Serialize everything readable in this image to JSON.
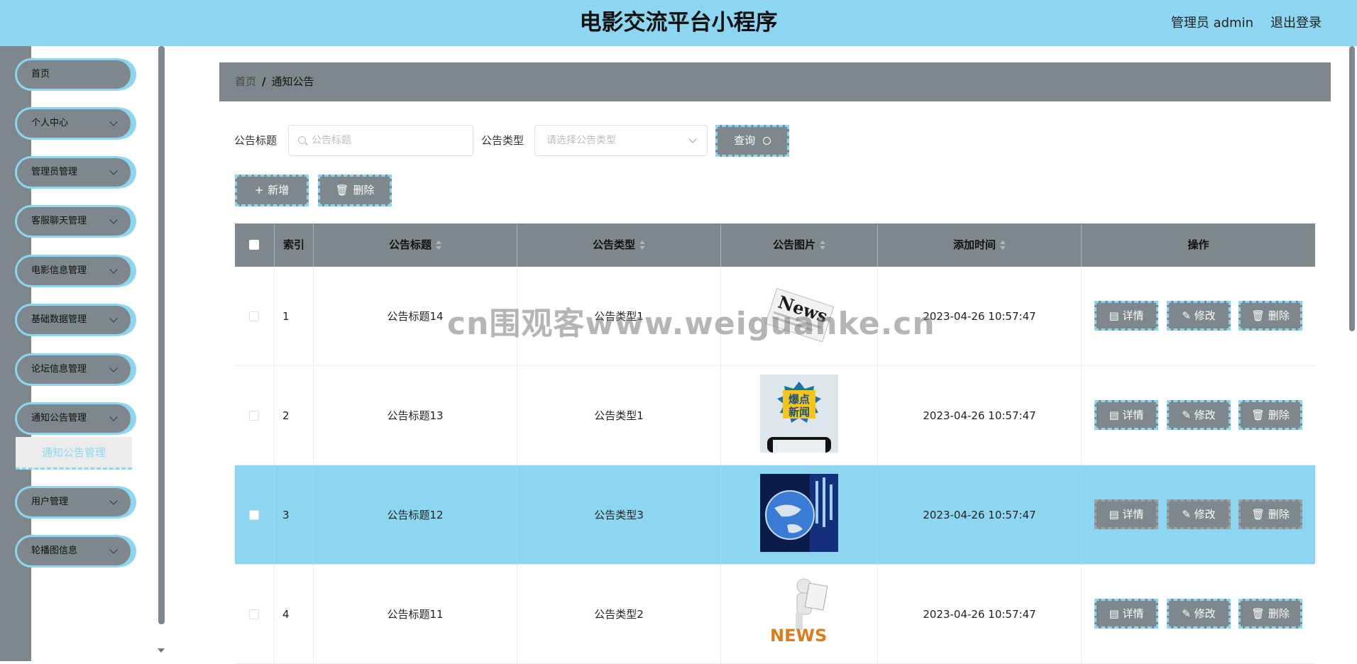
{
  "header": {
    "title": "电影交流平台小程序",
    "user": "管理员 admin",
    "logout": "退出登录"
  },
  "sidebar": {
    "items": [
      {
        "label": "首页",
        "has_children": false
      },
      {
        "label": "个人中心",
        "has_children": true
      },
      {
        "label": "管理员管理",
        "has_children": true
      },
      {
        "label": "客服聊天管理",
        "has_children": true
      },
      {
        "label": "电影信息管理",
        "has_children": true
      },
      {
        "label": "基础数据管理",
        "has_children": true
      },
      {
        "label": "论坛信息管理",
        "has_children": true
      },
      {
        "label": "通知公告管理",
        "has_children": true
      },
      {
        "label": "用户管理",
        "has_children": true
      },
      {
        "label": "轮播图信息",
        "has_children": true
      }
    ],
    "active_sub": "通知公告管理"
  },
  "breadcrumb": {
    "home": "首页",
    "sep": "/",
    "current": "通知公告"
  },
  "search": {
    "title_label": "公告标题",
    "title_placeholder": "公告标题",
    "type_label": "公告类型",
    "type_placeholder": "请选择公告类型",
    "query_button": "查询"
  },
  "actions": {
    "add": "新增",
    "delete": "删除"
  },
  "table": {
    "columns": [
      "索引",
      "公告标题",
      "公告类型",
      "公告图片",
      "添加时间",
      "操作"
    ],
    "rows": [
      {
        "index": "1",
        "title": "公告标题14",
        "type": "公告类型1",
        "image": "news-paper",
        "time": "2023-04-26 10:57:47",
        "highlight": false
      },
      {
        "index": "2",
        "title": "公告标题13",
        "type": "公告类型1",
        "image": "hot-news-phone",
        "time": "2023-04-26 10:57:47",
        "highlight": false
      },
      {
        "index": "3",
        "title": "公告标题12",
        "type": "公告类型3",
        "image": "globe-studio",
        "time": "2023-04-26 10:57:47",
        "highlight": true
      },
      {
        "index": "4",
        "title": "公告标题11",
        "type": "公告类型2",
        "image": "news-reader",
        "time": "2023-04-26 10:57:47",
        "highlight": false
      }
    ],
    "row_actions": {
      "detail": "详情",
      "edit": "修改",
      "delete": "删除"
    }
  },
  "watermark": "cn围观客www.weiguanke.cn",
  "colors": {
    "header": "#8dd6f1",
    "gray": "#7e878b",
    "accent": "#8dd6f1"
  }
}
